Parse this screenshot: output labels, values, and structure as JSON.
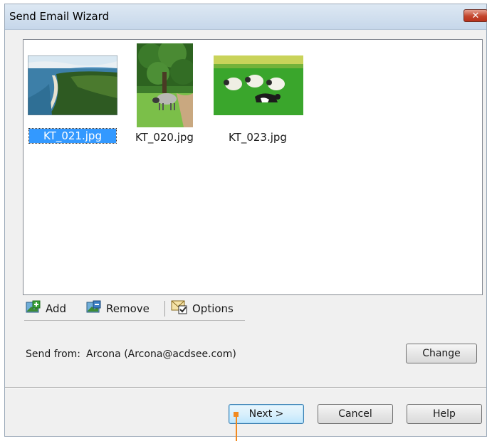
{
  "window": {
    "title": "Send Email Wizard",
    "close_symbol": "✕"
  },
  "files": [
    {
      "name": "KT_021.jpg",
      "selected": true,
      "image": "coastline-photo"
    },
    {
      "name": "KT_020.jpg",
      "selected": false,
      "image": "sheep-under-tree-photo"
    },
    {
      "name": "KT_023.jpg",
      "selected": false,
      "image": "sheep-and-dog-photo"
    }
  ],
  "toolbar": {
    "add_label": "Add",
    "remove_label": "Remove",
    "options_label": "Options"
  },
  "send_from": {
    "label": "Send from:",
    "value": "Arcona  (Arcona@acdsee.com)"
  },
  "buttons": {
    "change": "Change",
    "next": "Next >",
    "cancel": "Cancel",
    "help": "Help"
  }
}
